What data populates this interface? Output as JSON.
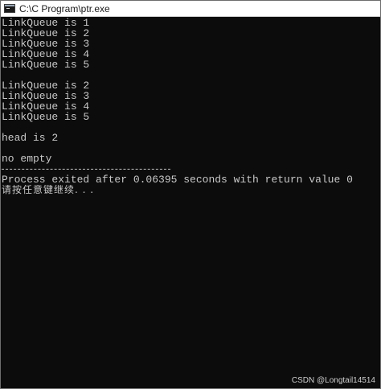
{
  "window": {
    "title": "C:\\C Program\\ptr.exe"
  },
  "console": {
    "first_pass": [
      "LinkQueue is 1",
      "LinkQueue is 2",
      "LinkQueue is 3",
      "LinkQueue is 4",
      "LinkQueue is 5"
    ],
    "second_pass": [
      "LinkQueue is 2",
      "LinkQueue is 3",
      "LinkQueue is 4",
      "LinkQueue is 5"
    ],
    "head": "head is 2",
    "empty_status": "no empty",
    "process_exit": "Process exited after 0.06395 seconds with return value 0",
    "press_any_key": "请按任意键继续. . ."
  },
  "watermark": "CSDN @Longtail14514",
  "colors": {
    "console_bg": "#0c0c0c",
    "console_text": "#c8c8c8",
    "titlebar_bg": "#ffffff"
  },
  "icons": {
    "app": "console-window-icon"
  }
}
